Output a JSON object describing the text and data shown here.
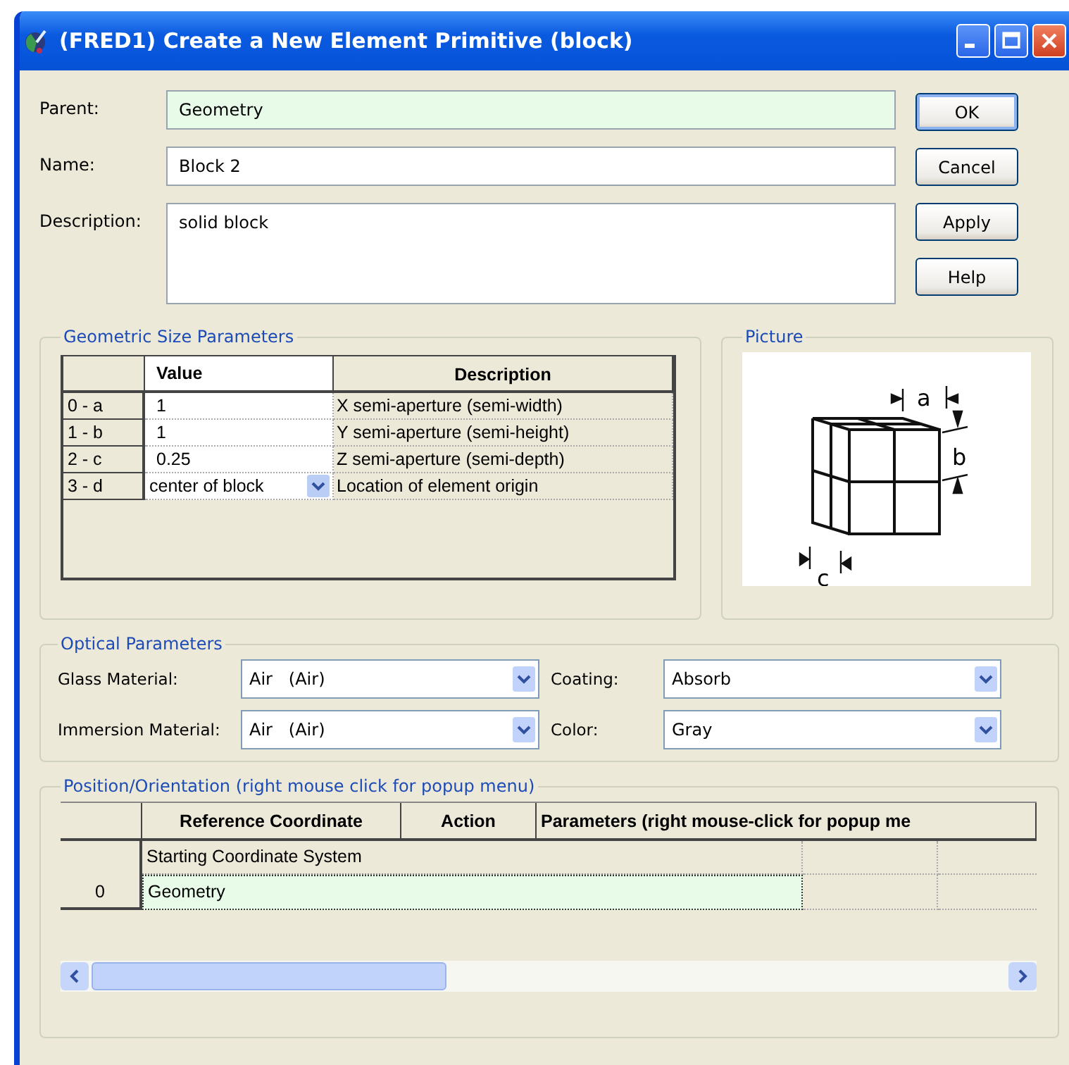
{
  "window": {
    "title": "(FRED1) Create a New Element Primitive (block)"
  },
  "fields": [
    {
      "label": "Parent:",
      "value": "Geometry",
      "readonly": true,
      "multiline": false
    },
    {
      "label": "Name:",
      "value": "Block 2",
      "readonly": false,
      "multiline": false
    },
    {
      "label": "Description:",
      "value": "solid block",
      "readonly": false,
      "multiline": true
    }
  ],
  "buttons": [
    {
      "label": "OK",
      "default": true
    },
    {
      "label": "Cancel",
      "default": false
    },
    {
      "label": "Apply",
      "default": false
    },
    {
      "label": "Help",
      "default": false
    }
  ],
  "geometric_size": {
    "title": "Geometric Size Parameters",
    "columns": [
      "Value",
      "Description"
    ],
    "rows": [
      {
        "index": "0 - a",
        "kind": "text",
        "value": "1",
        "description": "X semi-aperture (semi-width)"
      },
      {
        "index": "1 - b",
        "kind": "text",
        "value": "1",
        "description": "Y semi-aperture (semi-height)"
      },
      {
        "index": "2 - c",
        "kind": "text",
        "value": "0.25",
        "description": "Z semi-aperture (semi-depth)"
      },
      {
        "index": "3 - d",
        "kind": "dropdown",
        "value": "center of block",
        "description": "Location of element origin"
      }
    ]
  },
  "picture": {
    "title": "Picture",
    "labels": [
      "a",
      "b",
      "c"
    ]
  },
  "optical": {
    "title": "Optical Parameters",
    "fields": [
      {
        "label": "Glass Material:",
        "value": "Air   (Air)"
      },
      {
        "label": "Coating:",
        "value": "Absorb"
      },
      {
        "label": "Immersion Material:",
        "value": "Air   (Air)"
      },
      {
        "label": "Color:",
        "value": "Gray"
      }
    ]
  },
  "position": {
    "title": "Position/Orientation  (right mouse click for popup menu)",
    "columns": [
      "Reference Coordinate",
      "Action",
      "Parameters (right mouse-click for popup me"
    ],
    "rows": [
      {
        "index": "0",
        "lines": [
          {
            "text": "Starting Coordinate System",
            "selected": false
          },
          {
            "text": "Geometry",
            "selected": true
          }
        ]
      }
    ]
  }
}
